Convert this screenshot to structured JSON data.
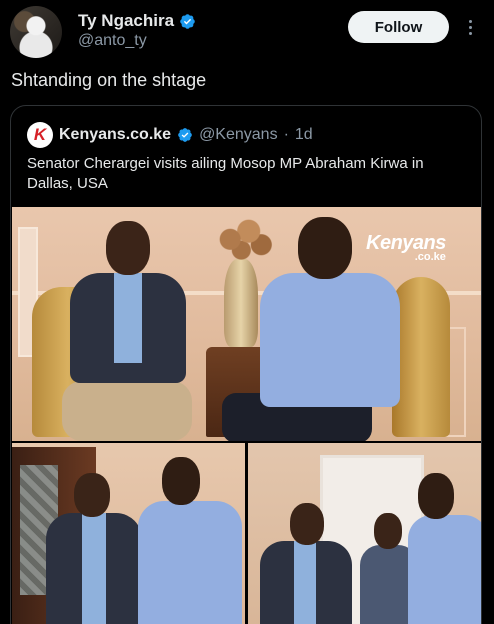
{
  "author": {
    "display_name": "Ty Ngachira",
    "handle": "@anto_ty",
    "verified": true,
    "avatar_icon": "profile-avatar"
  },
  "actions": {
    "follow_label": "Follow",
    "more_icon": "more-vertical-icon"
  },
  "tweet": {
    "text": "Shtanding on the shtage"
  },
  "quoted": {
    "logo_letter": "K",
    "name": "Kenyans.co.ke",
    "handle": "@Kenyans",
    "separator": "·",
    "time": "1d",
    "verified": true,
    "text": "Senator Cherargei visits ailing Mosop MP Abraham Kirwa in Dallas, USA",
    "watermark": {
      "main": "Kenyans",
      "sub": ".co.ke"
    }
  },
  "colors": {
    "background": "#000000",
    "text_primary": "#e7e9ea",
    "text_secondary": "#8b98a5",
    "verified_blue": "#1d9bf0",
    "follow_bg": "#eff3f4",
    "border": "#2f3336",
    "brand_red": "#d62027"
  }
}
